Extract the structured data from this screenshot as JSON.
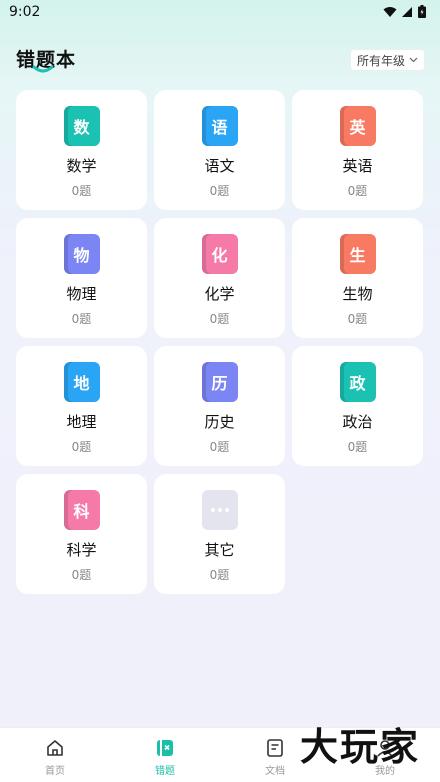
{
  "status": {
    "time": "9:02"
  },
  "header": {
    "title": "错题本",
    "grade_select": "所有年级"
  },
  "subjects": [
    {
      "icon_char": "数",
      "name": "数学",
      "count": "0题",
      "color": "#1bc1b3"
    },
    {
      "icon_char": "语",
      "name": "语文",
      "count": "0题",
      "color": "#2aa4f4"
    },
    {
      "icon_char": "英",
      "name": "英语",
      "count": "0题",
      "color": "#f87a62"
    },
    {
      "icon_char": "物",
      "name": "物理",
      "count": "0题",
      "color": "#7b86f4"
    },
    {
      "icon_char": "化",
      "name": "化学",
      "count": "0题",
      "color": "#f57aa8"
    },
    {
      "icon_char": "生",
      "name": "生物",
      "count": "0题",
      "color": "#f87a62"
    },
    {
      "icon_char": "地",
      "name": "地理",
      "count": "0题",
      "color": "#2aa4f4"
    },
    {
      "icon_char": "历",
      "name": "历史",
      "count": "0题",
      "color": "#7b86f4"
    },
    {
      "icon_char": "政",
      "name": "政治",
      "count": "0题",
      "color": "#1bc1b3"
    },
    {
      "icon_char": "科",
      "name": "科学",
      "count": "0题",
      "color": "#f57aa8"
    },
    {
      "icon_char": "",
      "name": "其它",
      "count": "0题",
      "color": "#e3e4ee"
    }
  ],
  "nav": [
    {
      "label": "首页",
      "icon": "home-icon"
    },
    {
      "label": "错题",
      "icon": "wrongbook-icon"
    },
    {
      "label": "文档",
      "icon": "document-icon"
    },
    {
      "label": "我的",
      "icon": "profile-icon"
    }
  ],
  "watermark": "大玩家"
}
